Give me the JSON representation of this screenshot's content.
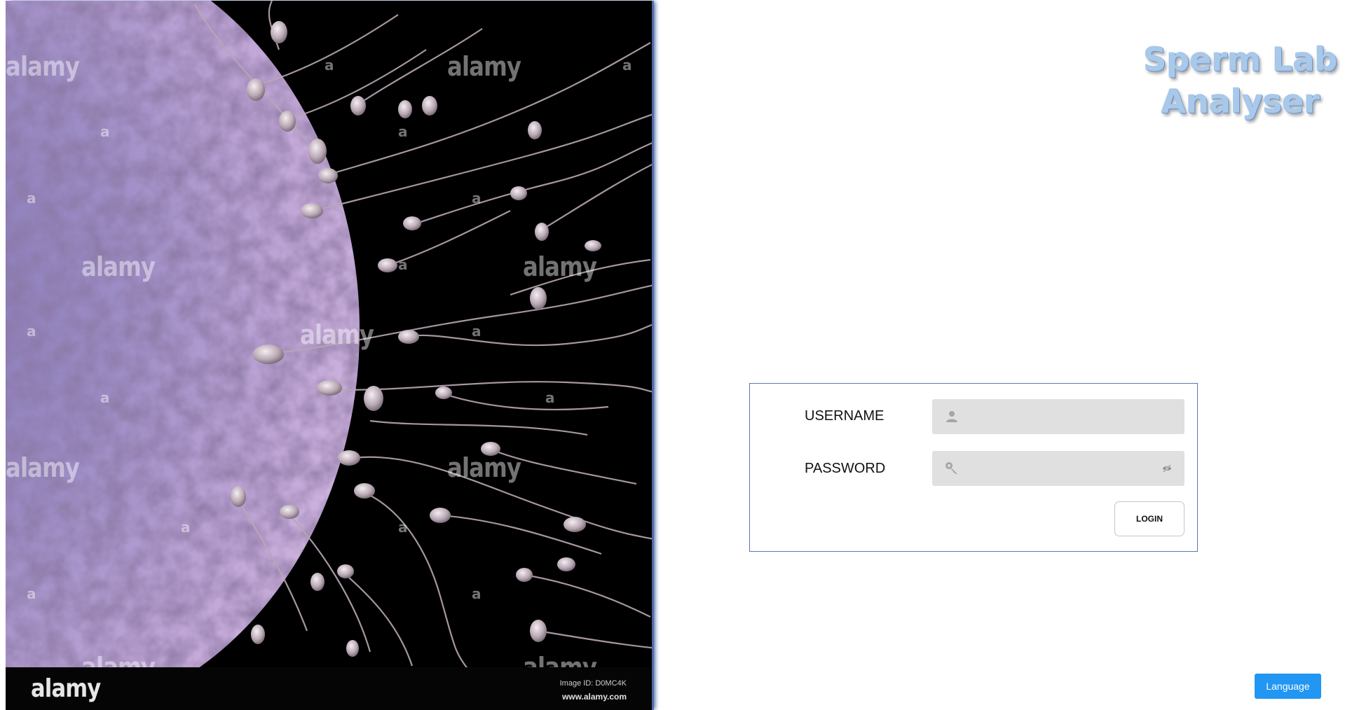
{
  "app": {
    "title_line1": "Sperm Lab",
    "title_line2": "Analyser"
  },
  "hero_image": {
    "description_icon": "egg-cell-sperm-image",
    "watermark": "alamy",
    "watermark_letter": "a",
    "footer_logo": "alamy",
    "image_id": "Image ID: D0MC4K",
    "url": "www.alamy.com"
  },
  "login": {
    "username_label": "USERNAME",
    "password_label": "PASSWORD",
    "username_value": "",
    "password_value": "",
    "username_icon": "person-icon",
    "password_icon": "key-icon",
    "visibility_icon": "eye-off-icon",
    "login_label": "LOGIN"
  },
  "language": {
    "label": "Language"
  },
  "colors": {
    "accent": "#2196f3",
    "card_border": "#5b76b3",
    "input_bg": "#e0e0e0",
    "title": "#a9c9ea"
  }
}
